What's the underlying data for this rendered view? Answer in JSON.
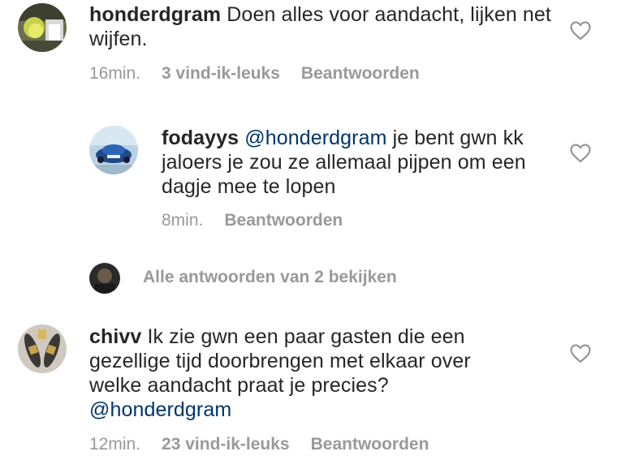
{
  "comments": [
    {
      "username": "honderdgram",
      "text": "Doen alles voor aandacht, lijken net wijfen.",
      "time": "16min.",
      "likes": "3 vind-ik-leuks",
      "reply": "Beantwoorden"
    },
    {
      "username": "fodayys",
      "mention": "@honderdgram",
      "text": "je bent gwn kk jaloers je zou ze allemaal pijpen om een dagje mee te lopen",
      "time": "8min.",
      "reply": "Beantwoorden"
    },
    {
      "username": "chivv",
      "text": "Ik zie gwn een paar gasten die een gezellige tijd doorbrengen met elkaar over welke aandacht praat je precies?",
      "mention": "@honderdgram",
      "time": "12min.",
      "likes": "23 vind-ik-leuks",
      "reply": "Beantwoorden"
    }
  ],
  "view_replies": "Alle antwoorden van 2 bekijken",
  "icons": {
    "like": "heart-outline-icon"
  },
  "colors": {
    "text": "#262626",
    "meta": "#999999",
    "mention": "#003569"
  }
}
